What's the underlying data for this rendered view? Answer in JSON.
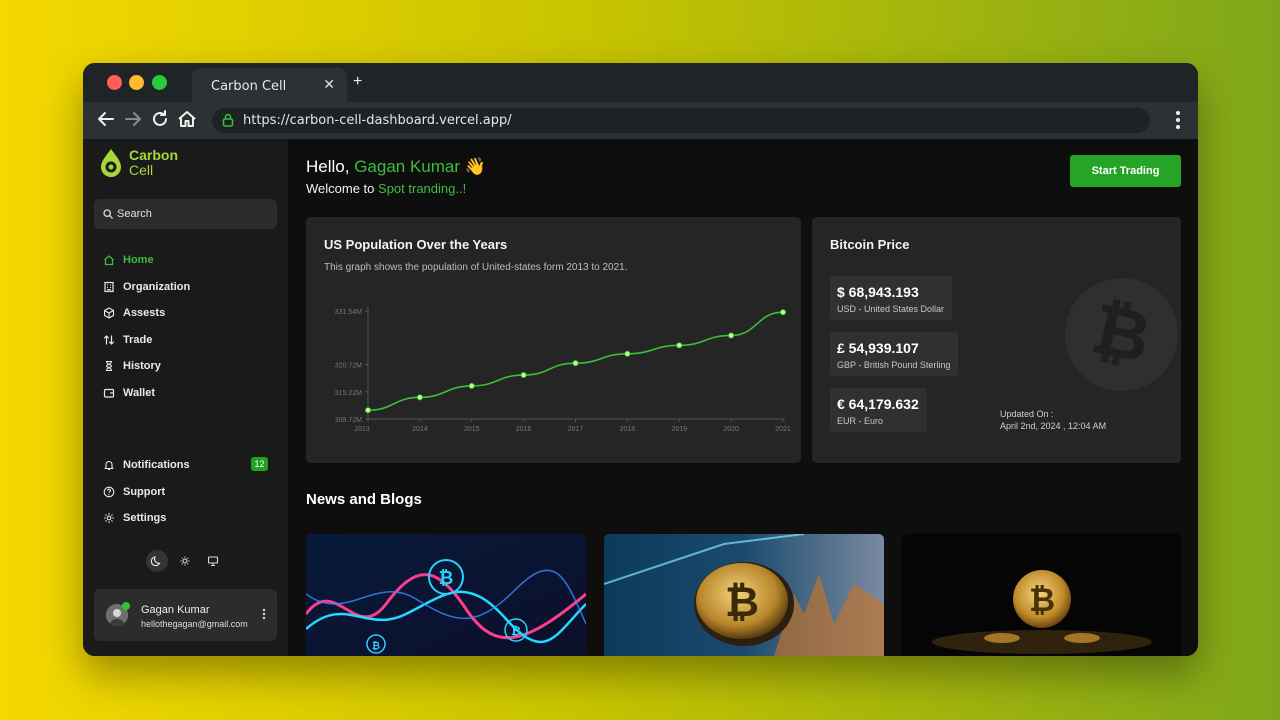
{
  "browser": {
    "tab_title": "Carbon Cell",
    "tab_close": "✕",
    "new_tab": "+",
    "url": "https://carbon-cell-dashboard.vercel.app/"
  },
  "brand": {
    "line1": "Carbon",
    "line2": "Cell",
    "color": "#a8d63a"
  },
  "sidebar": {
    "search_placeholder": "Search",
    "nav": [
      {
        "label": "Home",
        "icon": "home-icon",
        "active": true
      },
      {
        "label": "Organization",
        "icon": "building-icon"
      },
      {
        "label": "Assests",
        "icon": "cube-icon"
      },
      {
        "label": "Trade",
        "icon": "swap-icon"
      },
      {
        "label": "History",
        "icon": "hourglass-icon"
      },
      {
        "label": "Wallet",
        "icon": "wallet-icon"
      }
    ],
    "bottom_nav": [
      {
        "label": "Notifications",
        "icon": "bell-icon",
        "badge": "12"
      },
      {
        "label": "Support",
        "icon": "help-circle-icon"
      },
      {
        "label": "Settings",
        "icon": "gear-icon"
      }
    ],
    "user": {
      "name": "Gagan Kumar",
      "email": "hellothegagan@gmail.com"
    }
  },
  "header": {
    "hello": "Hello,",
    "name": "Gagan Kumar",
    "wave": "👋",
    "welcome": "Welcome to",
    "welcome_highlight": "Spot tranding..!",
    "cta": "Start Trading"
  },
  "population_card": {
    "title": "US Population Over the Years",
    "subtitle": "This graph shows the population of United-states form 2013 to 2021."
  },
  "chart_data": {
    "type": "line",
    "x": [
      "2013",
      "2014",
      "2015",
      "2016",
      "2017",
      "2018",
      "2019",
      "2020",
      "2021"
    ],
    "y_ticks": [
      "309.72M",
      "315.22M",
      "320.72M",
      "331.54M"
    ],
    "series": [
      {
        "values": [
          311.5,
          314.1,
          316.4,
          318.6,
          321.0,
          322.9,
          324.6,
          326.6,
          331.3
        ]
      }
    ],
    "ylim": [
      309.72,
      331.54
    ],
    "color": "#3dbd3d"
  },
  "bitcoin_card": {
    "title": "Bitcoin Price",
    "prices": [
      {
        "value": "$ 68,943.193",
        "label": "USD - United States Dollar"
      },
      {
        "value": "£ 54,939.107",
        "label": "GBP - British Pound Sterling"
      },
      {
        "value": "€ 64,179.632",
        "label": "EUR - Euro"
      }
    ],
    "updated_label": "Updated On :",
    "updated_time": "April 2nd, 2024 , 12:04 AM"
  },
  "news": {
    "title": "News and Blogs"
  },
  "colors": {
    "accent": "#3dbd3d",
    "button": "#25a425"
  }
}
